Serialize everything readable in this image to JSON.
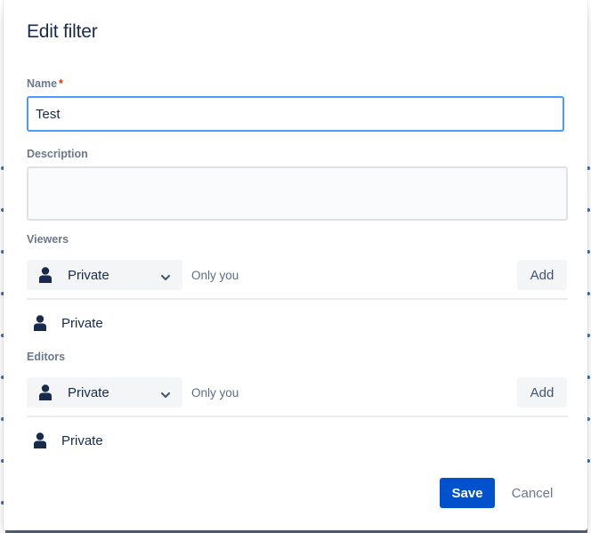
{
  "dialog": {
    "title": "Edit filter"
  },
  "name_field": {
    "label": "Name",
    "required_marker": "*",
    "value": "Test"
  },
  "description_field": {
    "label": "Description",
    "value": ""
  },
  "viewers": {
    "label": "Viewers",
    "select_value": "Private",
    "hint": "Only you",
    "add_label": "Add",
    "entries": [
      {
        "icon": "person-icon",
        "label": "Private"
      }
    ]
  },
  "editors": {
    "label": "Editors",
    "select_value": "Private",
    "hint": "Only you",
    "add_label": "Add",
    "entries": [
      {
        "icon": "person-icon",
        "label": "Private"
      }
    ]
  },
  "footer": {
    "save_label": "Save",
    "cancel_label": "Cancel"
  },
  "colors": {
    "primary": "#0052cc",
    "focus_border": "#4c9aff",
    "text": "#172b4d",
    "muted": "#6b778c",
    "required": "#de350b",
    "button_bg": "#f4f5f7"
  }
}
